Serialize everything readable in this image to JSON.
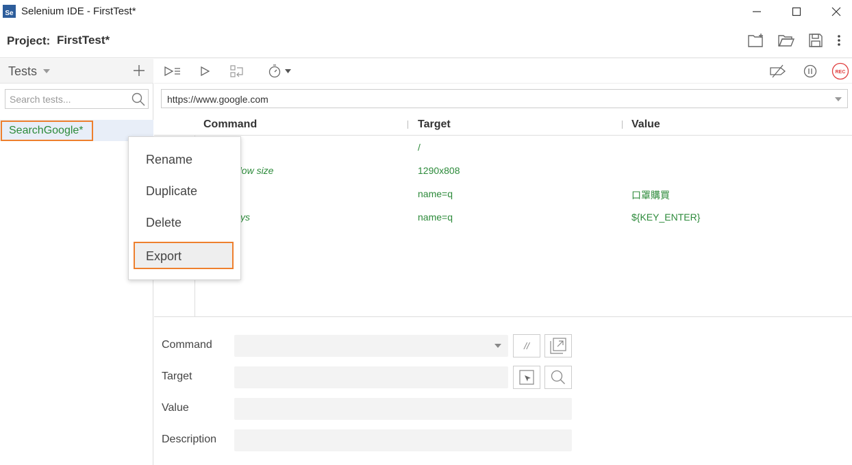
{
  "window": {
    "logo_text": "Se",
    "title": "Selenium IDE - FirstTest*"
  },
  "project": {
    "label": "Project:",
    "name": "FirstTest*"
  },
  "sidebar": {
    "heading": "Tests",
    "search_placeholder": "Search tests...",
    "tests": [
      {
        "name": "SearchGoogle*"
      }
    ]
  },
  "url_bar": {
    "value": "https://www.google.com"
  },
  "table": {
    "headers": {
      "command": "Command",
      "target": "Target",
      "value": "Value"
    },
    "rows": [
      {
        "command": "",
        "target": "/",
        "value": ""
      },
      {
        "command": "dow size",
        "target": "1290x808",
        "value": ""
      },
      {
        "command": "",
        "target": "name=q",
        "value": "口罩購買"
      },
      {
        "command": "ys",
        "target": "name=q",
        "value": "${KEY_ENTER}"
      }
    ]
  },
  "context_menu": {
    "items": [
      "Rename",
      "Duplicate",
      "Delete",
      "Export"
    ],
    "highlighted": "Export"
  },
  "editor": {
    "command_label": "Command",
    "target_label": "Target",
    "value_label": "Value",
    "description_label": "Description",
    "comment_button": "//"
  },
  "colors": {
    "accent": "#ee7f2d",
    "command_text": "#2c8a3a",
    "record": "#e03c3c",
    "logo": "#2d5d9b"
  }
}
